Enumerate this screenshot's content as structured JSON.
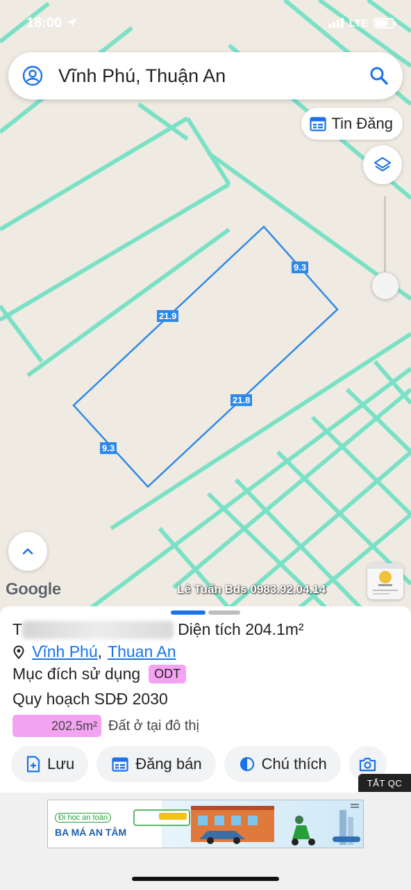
{
  "status_bar": {
    "time": "18:00",
    "network": "LTE"
  },
  "search": {
    "value": "Vĩnh Phú, Thuận An"
  },
  "listing_button": {
    "label": "Tin Đăng"
  },
  "map": {
    "attribution": "Google",
    "watermark": "Lê Tuấn Bds 0983.92.04.14",
    "dimensions": {
      "top_right": "9.3",
      "top_left": "21.9",
      "bottom_right": "21.8",
      "bottom_left": "9.3"
    },
    "colors": {
      "parcel_lines": "#6fe0c4",
      "selected_outline": "#2e89e6"
    }
  },
  "sheet": {
    "title_prefix": "T",
    "area_label": "Diện tích 204.1m²",
    "location": {
      "ward": "Vĩnh Phú",
      "separator": ",",
      "district": "Thuan An"
    },
    "usage_label": "Mục đích sử dụng",
    "usage_code": "ODT",
    "plan_label": "Quy hoạch SDĐ 2030",
    "plan_area": "202.5m²",
    "plan_desc": "Đất ở tại đô thị",
    "actions": [
      "Lưu",
      "Đăng bán",
      "Chú thích"
    ],
    "badge_color": "#f3a3f2"
  },
  "ad": {
    "close_label": "TẮT QC",
    "headline_top": "Đi học an toàn",
    "headline_bottom": "BA MÁ AN TÂM"
  }
}
